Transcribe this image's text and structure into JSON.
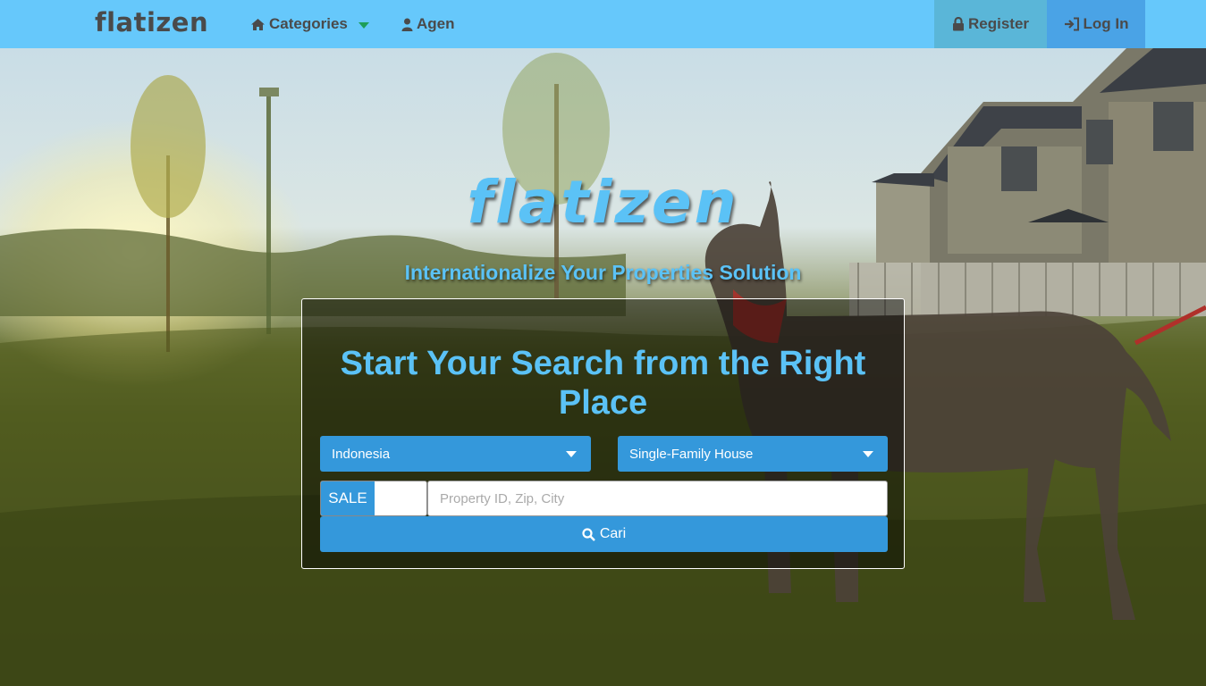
{
  "navbar": {
    "brand": "flatizen",
    "categories_label": "Categories",
    "agen_label": "Agen",
    "register_label": "Register",
    "login_label": "Log In"
  },
  "hero": {
    "logo_text": "flatizen",
    "tagline": "Internationalize Your Properties Solution"
  },
  "search": {
    "heading": "Start Your Search from the Right Place",
    "country_selected": "Indonesia",
    "property_type_selected": "Single-Family House",
    "listing_type": "SALE",
    "input_value": "",
    "input_placeholder": "Property ID, Zip, City",
    "submit_label": "Cari"
  },
  "colors": {
    "navbar_bg": "#66c8fb",
    "accent_blue": "#3498db",
    "headline_blue": "#5bc2f6",
    "caret_green": "#1e9e5a"
  },
  "icons": [
    "home-icon",
    "user-icon",
    "lock-icon",
    "sign-in-icon",
    "search-icon",
    "caret-down-icon"
  ]
}
